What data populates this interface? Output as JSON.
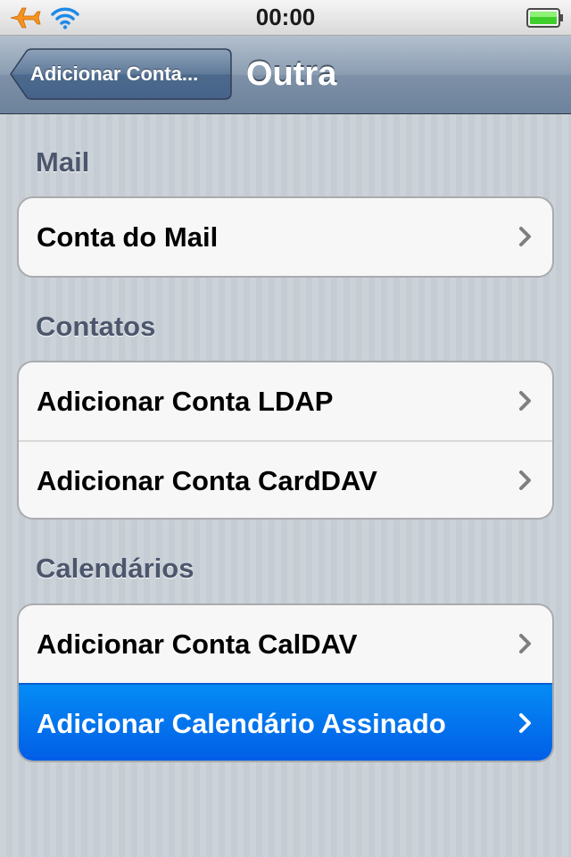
{
  "status_bar": {
    "time": "00:00",
    "icons": [
      "airplane-icon",
      "wifi-icon",
      "battery-icon"
    ],
    "accent_color": "#f7931e",
    "battery_level": 1.0
  },
  "nav": {
    "back_label": "Adicionar Conta...",
    "title": "Outra"
  },
  "sections": [
    {
      "header": "Mail",
      "rows": [
        {
          "label": "Conta do Mail",
          "icon": "chevron-right-icon"
        }
      ]
    },
    {
      "header": "Contatos",
      "rows": [
        {
          "label": "Adicionar Conta LDAP",
          "icon": "chevron-right-icon"
        },
        {
          "label": "Adicionar Conta CardDAV",
          "icon": "chevron-right-icon"
        }
      ]
    },
    {
      "header": "Calendários",
      "rows": [
        {
          "label": "Adicionar Conta CalDAV",
          "icon": "chevron-right-icon"
        },
        {
          "label": "Adicionar Calendário Assinado",
          "icon": "chevron-right-icon",
          "selected": true
        }
      ]
    }
  ],
  "colors": {
    "selection": "#0a6fe8",
    "section_header": "#4c566c",
    "nav_bar": "#8b9db2"
  }
}
